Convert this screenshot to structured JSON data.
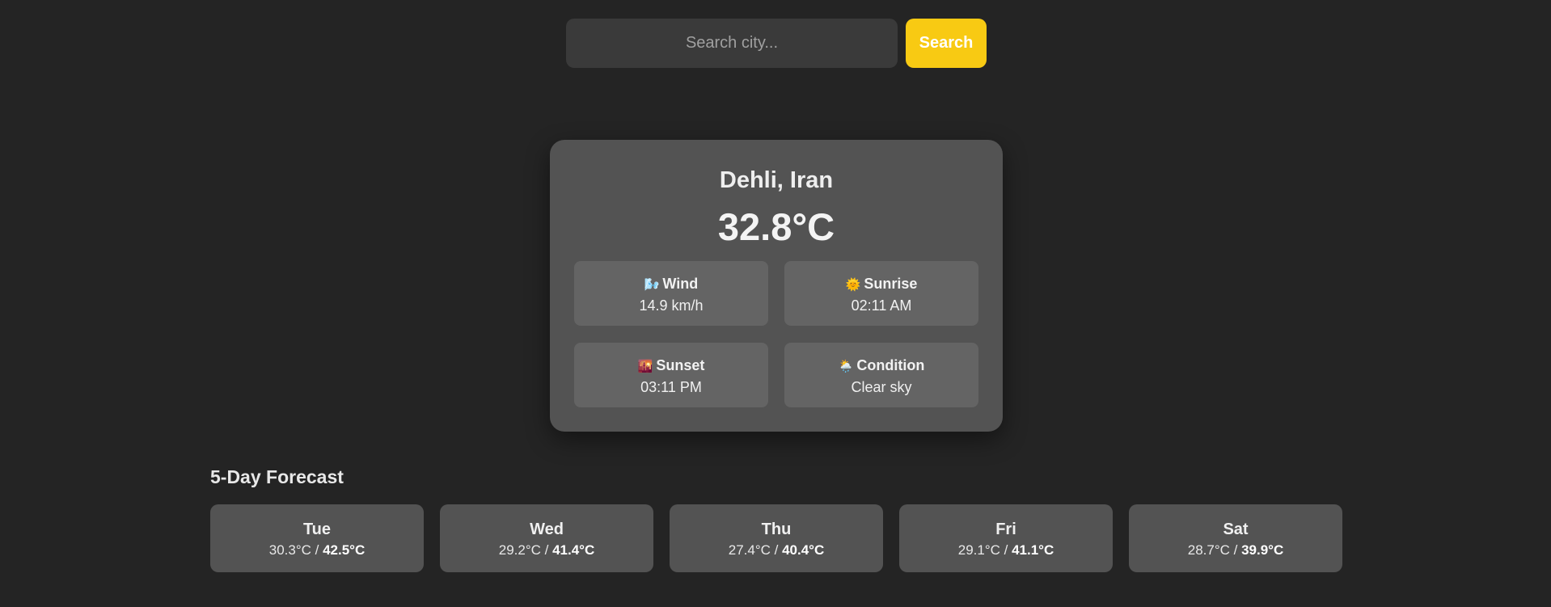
{
  "search": {
    "placeholder": "Search city...",
    "value": "",
    "button_label": "Search"
  },
  "current": {
    "city": "Dehli, Iran",
    "temperature": "32.8°C",
    "details": [
      {
        "icon": "wind-icon",
        "glyph": "🌬️",
        "label": "Wind",
        "value": "14.9 km/h"
      },
      {
        "icon": "sunrise-icon",
        "glyph": "🌞",
        "label": "Sunrise",
        "value": "02:11 AM"
      },
      {
        "icon": "sunset-icon",
        "glyph": "🌇",
        "label": "Sunset",
        "value": "03:11 PM"
      },
      {
        "icon": "condition-icon",
        "glyph": "🌦️",
        "label": "Condition",
        "value": "Clear sky"
      }
    ]
  },
  "forecast": {
    "title": "5-Day Forecast",
    "days": [
      {
        "day": "Tue",
        "min": "30.3°C",
        "separator": " / ",
        "max": "42.5°C"
      },
      {
        "day": "Wed",
        "min": "29.2°C",
        "separator": " / ",
        "max": "41.4°C"
      },
      {
        "day": "Thu",
        "min": "27.4°C",
        "separator": " / ",
        "max": "40.4°C"
      },
      {
        "day": "Fri",
        "min": "29.1°C",
        "separator": " / ",
        "max": "41.1°C"
      },
      {
        "day": "Sat",
        "min": "28.7°C",
        "separator": " / ",
        "max": "39.9°C"
      }
    ]
  },
  "colors": {
    "background": "#242424",
    "card": "#535353",
    "accent": "#f8ca13"
  }
}
